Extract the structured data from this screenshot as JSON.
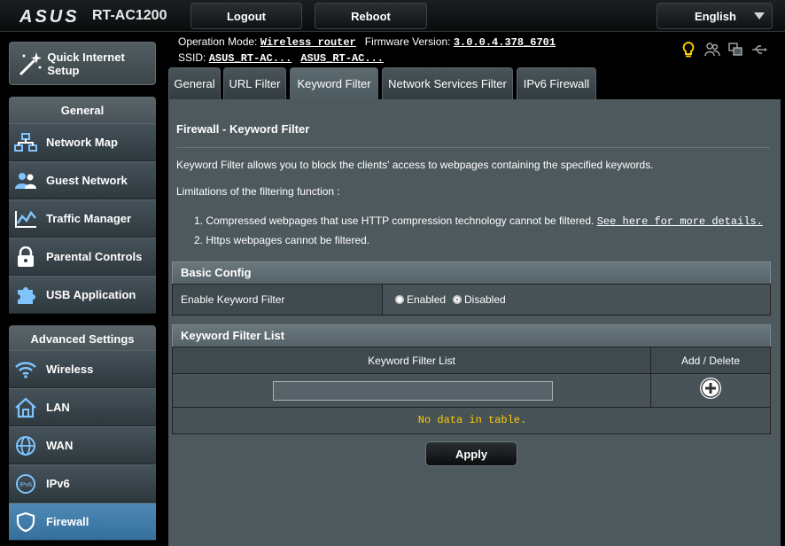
{
  "header": {
    "brand": "ASUS",
    "model": "RT-AC1200",
    "logout_label": "Logout",
    "reboot_label": "Reboot",
    "language": "English"
  },
  "sidebar": {
    "quick_setup": "Quick Internet Setup",
    "general_title": "General",
    "general_items": [
      {
        "label": "Network Map",
        "icon": "network-map-icon"
      },
      {
        "label": "Guest Network",
        "icon": "guest-network-icon"
      },
      {
        "label": "Traffic Manager",
        "icon": "traffic-manager-icon"
      },
      {
        "label": "Parental Controls",
        "icon": "lock-icon"
      },
      {
        "label": "USB Application",
        "icon": "puzzle-icon"
      }
    ],
    "advanced_title": "Advanced Settings",
    "advanced_items": [
      {
        "label": "Wireless",
        "icon": "wifi-icon"
      },
      {
        "label": "LAN",
        "icon": "house-icon"
      },
      {
        "label": "WAN",
        "icon": "globe-icon"
      },
      {
        "label": "IPv6",
        "icon": "ipv6-icon"
      },
      {
        "label": "Firewall",
        "icon": "shield-icon"
      }
    ]
  },
  "info": {
    "op_mode_label": "Operation Mode:",
    "op_mode_value": "Wireless router",
    "fw_label": "Firmware Version:",
    "fw_value": "3.0.0.4.378_6701",
    "ssid_label": "SSID:",
    "ssid_1": "ASUS_RT-AC...",
    "ssid_2": "ASUS_RT-AC..."
  },
  "tabs": [
    "General",
    "URL Filter",
    "Keyword Filter",
    "Network Services Filter",
    "IPv6 Firewall"
  ],
  "content": {
    "title": "Firewall - Keyword Filter",
    "description": "Keyword Filter allows you to block the clients' access to webpages containing the specified keywords.",
    "limitations_title": "Limitations of the filtering function :",
    "limitation_1": "1.  Compressed webpages that use HTTP compression technology cannot be filtered.",
    "limitation_1_link": "See here for more details.",
    "limitation_2": "2.  Https webpages cannot be filtered."
  },
  "basic_config": {
    "header": "Basic Config",
    "enable_label": "Enable Keyword Filter",
    "enabled": "Enabled",
    "disabled": "Disabled",
    "selected": "Disabled"
  },
  "keyword_list": {
    "header": "Keyword Filter List",
    "col_list": "Keyword Filter List",
    "col_action": "Add / Delete",
    "input_value": "",
    "empty_text": "No data in table."
  },
  "apply_label": "Apply",
  "colors": {
    "panel": "#4d595d",
    "active_nav": "#4f88b5",
    "warning_text": "#ffcc00"
  }
}
